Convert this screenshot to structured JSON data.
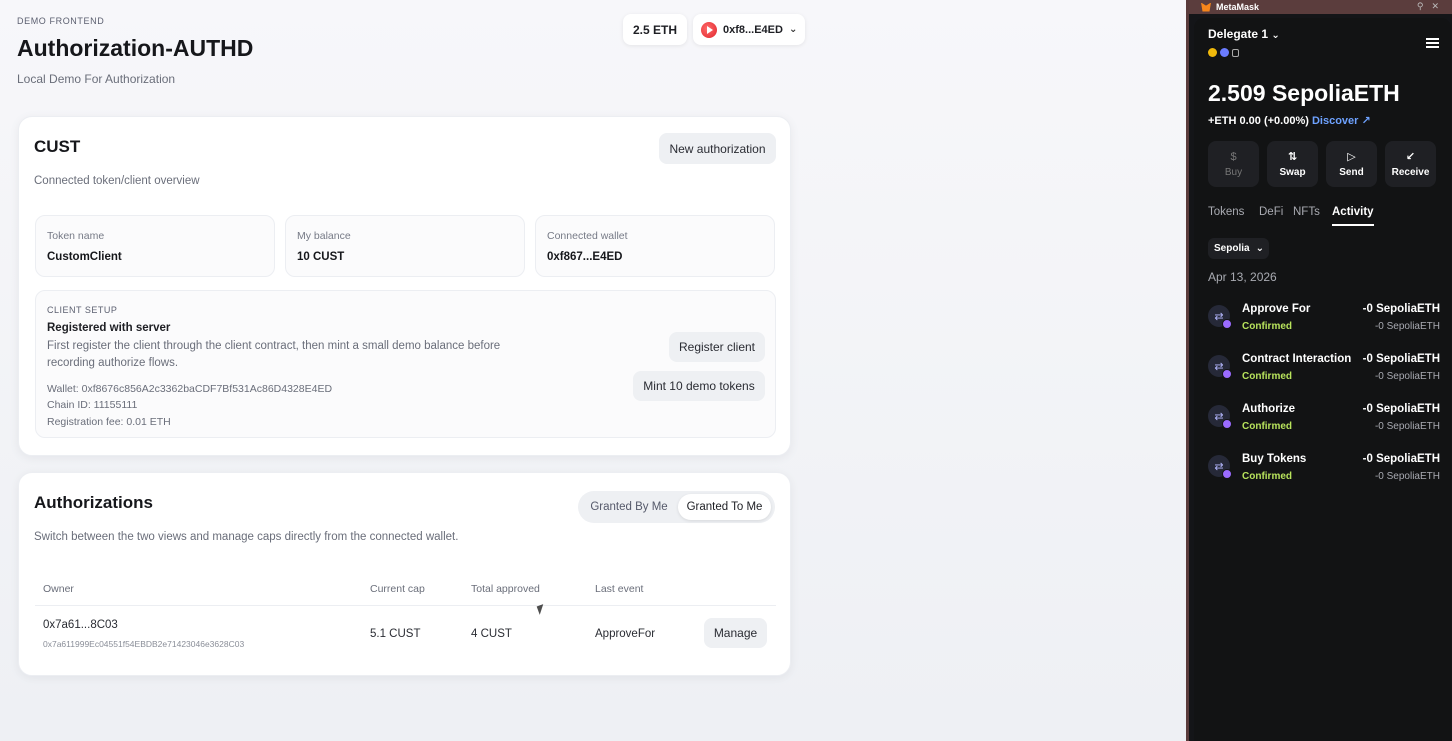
{
  "app": {
    "eyebrow": "DEMO FRONTEND",
    "title": "Authorization-AUTHD",
    "subtitle": "Local Demo For Authorization",
    "wallet": {
      "eth": "2.5 ETH",
      "address": "0xf8...E4ED"
    }
  },
  "cust": {
    "title": "CUST",
    "new_auth_label": "New authorization",
    "description": "Connected token/client overview",
    "stats": [
      {
        "label": "Token name",
        "value": "CustomClient"
      },
      {
        "label": "My balance",
        "value": "10 CUST"
      },
      {
        "label": "Connected wallet",
        "value": "0xf867...E4ED"
      }
    ],
    "setup": {
      "eyebrow": "CLIENT SETUP",
      "heading": "Registered with server",
      "text": "First register the client through the client contract, then mint a small demo balance before recording authorize flows.",
      "wallet": "Wallet: 0xf8676c856A2c3362baCDF7Bf531Ac86D4328E4ED",
      "chain": "Chain ID: 11155111",
      "fee": "Registration fee: 0.01 ETH",
      "register_label": "Register client",
      "mint_label": "Mint 10 demo tokens"
    }
  },
  "auths": {
    "title": "Authorizations",
    "description": "Switch between the two views and manage caps directly from the connected wallet.",
    "toggle": {
      "by_me": "Granted By Me",
      "to_me": "Granted To Me"
    },
    "headers": [
      "Owner",
      "Current cap",
      "Total approved",
      "Last event"
    ],
    "rows": [
      {
        "owner_short": "0x7a61...8C03",
        "owner_full": "0x7a611999Ec04551f54EBDB2e71423046e3628C03",
        "cap": "5.1 CUST",
        "total": "4 CUST",
        "event": "ApproveFor",
        "action": "Manage"
      }
    ]
  },
  "metamask": {
    "app_name": "MetaMask",
    "account": "Delegate 1",
    "balance": "2.509 SepoliaETH",
    "change": "+ETH 0.00 (+0.00%)",
    "discover": "Discover",
    "actions": [
      {
        "label": "Buy",
        "icon": "dollar-icon",
        "glyph": "$"
      },
      {
        "label": "Swap",
        "icon": "swap-icon",
        "glyph": "⇅"
      },
      {
        "label": "Send",
        "icon": "send-icon",
        "glyph": "▷"
      },
      {
        "label": "Receive",
        "icon": "receive-icon",
        "glyph": "↙"
      }
    ],
    "tabs": [
      "Tokens",
      "DeFi",
      "NFTs",
      "Activity"
    ],
    "network": "Sepolia",
    "date": "Apr 13, 2026",
    "transactions": [
      {
        "title": "Approve For",
        "status": "Confirmed",
        "amount": "-0 SepoliaETH",
        "sub": "-0 SepoliaETH"
      },
      {
        "title": "Contract Interaction",
        "status": "Confirmed",
        "amount": "-0 SepoliaETH",
        "sub": "-0 SepoliaETH"
      },
      {
        "title": "Authorize",
        "status": "Confirmed",
        "amount": "-0 SepoliaETH",
        "sub": "-0 SepoliaETH"
      },
      {
        "title": "Buy Tokens",
        "status": "Confirmed",
        "amount": "-0 SepoliaETH",
        "sub": "-0 SepoliaETH"
      }
    ],
    "colors": {
      "confirmed": "#b8e35c",
      "link": "#6ea2ff"
    }
  }
}
